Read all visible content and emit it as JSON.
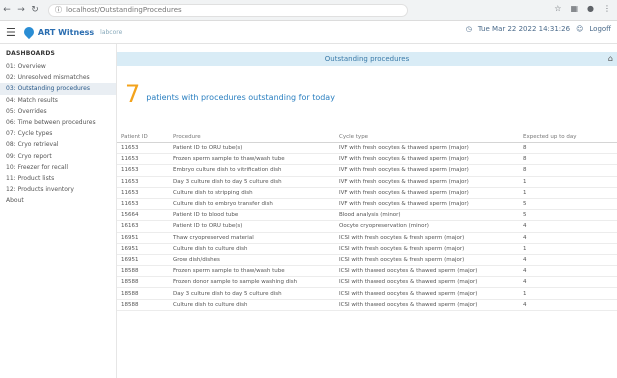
{
  "browser": {
    "url": "localhost/OutstandingProcedures",
    "icons": [
      "star-icon",
      "extension-icon",
      "profile-icon",
      "menu-icon"
    ]
  },
  "app": {
    "title": "ART Witness",
    "subtitle": "labcore",
    "datetime": "Tue Mar 22 2022 14:31:26",
    "logoff_label": "Logoff",
    "brand_color": "#2a8dd4",
    "accent_color": "#f3a31c"
  },
  "sidebar": {
    "title": "DASHBOARDS",
    "items": [
      {
        "label": "01: Overview"
      },
      {
        "label": "02: Unresolved mismatches"
      },
      {
        "label": "03: Outstanding procedures"
      },
      {
        "label": "04: Match results"
      },
      {
        "label": "05: Overrides"
      },
      {
        "label": "06: Time between procedures"
      },
      {
        "label": "07: Cycle types"
      },
      {
        "label": "08: Cryo retrieval"
      },
      {
        "label": "09: Cryo report"
      },
      {
        "label": "10: Freezer for recall"
      },
      {
        "label": "11: Product lists"
      },
      {
        "label": "12: Products inventory"
      },
      {
        "label": "About"
      }
    ]
  },
  "panel": {
    "title": "Outstanding procedures",
    "count": "7",
    "summary": "patients with procedures outstanding for today"
  },
  "table": {
    "headers": [
      "Patient ID",
      "Procedure",
      "Cycle type",
      "Expected up to day"
    ],
    "rows": [
      [
        "11653",
        "Patient ID to ORU tube(s)",
        "IVF with fresh oocytes & thawed sperm (major)",
        "8"
      ],
      [
        "11653",
        "Frozen sperm sample to thaw/wash tube",
        "IVF with fresh oocytes & thawed sperm (major)",
        "8"
      ],
      [
        "11653",
        "Embryo culture dish to vitrification dish",
        "IVF with fresh oocytes & thawed sperm (major)",
        "8"
      ],
      [
        "11653",
        "Day 3 culture dish to day 5 culture dish",
        "IVF with fresh oocytes & thawed sperm (major)",
        "1"
      ],
      [
        "11653",
        "Culture dish to stripping dish",
        "IVF with fresh oocytes & thawed sperm (major)",
        "1"
      ],
      [
        "11653",
        "Culture dish to embryo transfer dish",
        "IVF with fresh oocytes & thawed sperm (major)",
        "5"
      ],
      [
        "15664",
        "Patient ID to blood tube",
        "Blood analysis (minor)",
        "5"
      ],
      [
        "16163",
        "Patient ID to ORU tube(s)",
        "Oocyte cryopreservation (minor)",
        "4"
      ],
      [
        "16951",
        "Thaw cryopreserved material",
        "ICSI with fresh oocytes & fresh sperm (major)",
        "4"
      ],
      [
        "16951",
        "Culture dish to culture dish",
        "ICSI with fresh oocytes & fresh sperm (major)",
        "1"
      ],
      [
        "16951",
        "Grow dish/dishes",
        "ICSI with fresh oocytes & fresh sperm (major)",
        "4"
      ],
      [
        "18588",
        "Frozen sperm sample to thaw/wash tube",
        "ICSI with thawed oocytes & thawed sperm (major)",
        "4"
      ],
      [
        "18588",
        "Frozen donor sample to sample washing dish",
        "ICSI with thawed oocytes & thawed sperm (major)",
        "4"
      ],
      [
        "18588",
        "Day 3 culture dish to day 5 culture dish",
        "ICSI with thawed oocytes & thawed sperm (major)",
        "1"
      ],
      [
        "18588",
        "Culture dish to culture dish",
        "ICSI with thawed oocytes & thawed sperm (major)",
        "4"
      ]
    ]
  }
}
